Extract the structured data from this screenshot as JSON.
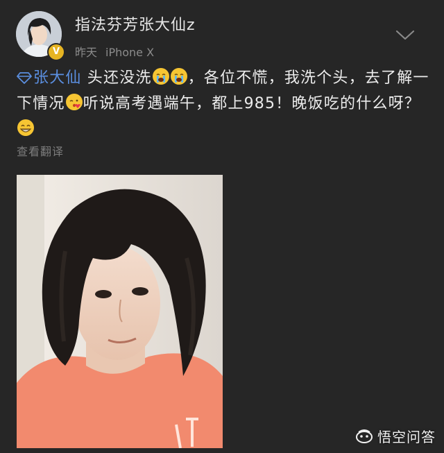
{
  "post": {
    "username": "指法芬芳张大仙z",
    "time": "昨天",
    "device": "iPhone X",
    "mention": "张大仙",
    "text_part1": " 头还没洗",
    "text_part2": "，各位不慌，我洗个头，去了解一下情况",
    "text_part3": "听说高考遇端午，都上985！晚饭吃的什么呀？",
    "translate_label": "查看翻译",
    "verified_badge": "V"
  },
  "watermark": {
    "label": "悟空问答"
  },
  "colors": {
    "background": "#262626",
    "mention": "#5b8fe0",
    "meta": "#8c8c8c",
    "verified": "#e6b422"
  },
  "icons": {
    "more": "chevron-down-icon",
    "mention": "diamond-icon",
    "emoji1": "loudly-crying-face-icon",
    "emoji2": "face-blowing-kiss-icon",
    "emoji3": "grinning-face-icon",
    "watermark": "wukong-logo-icon"
  }
}
